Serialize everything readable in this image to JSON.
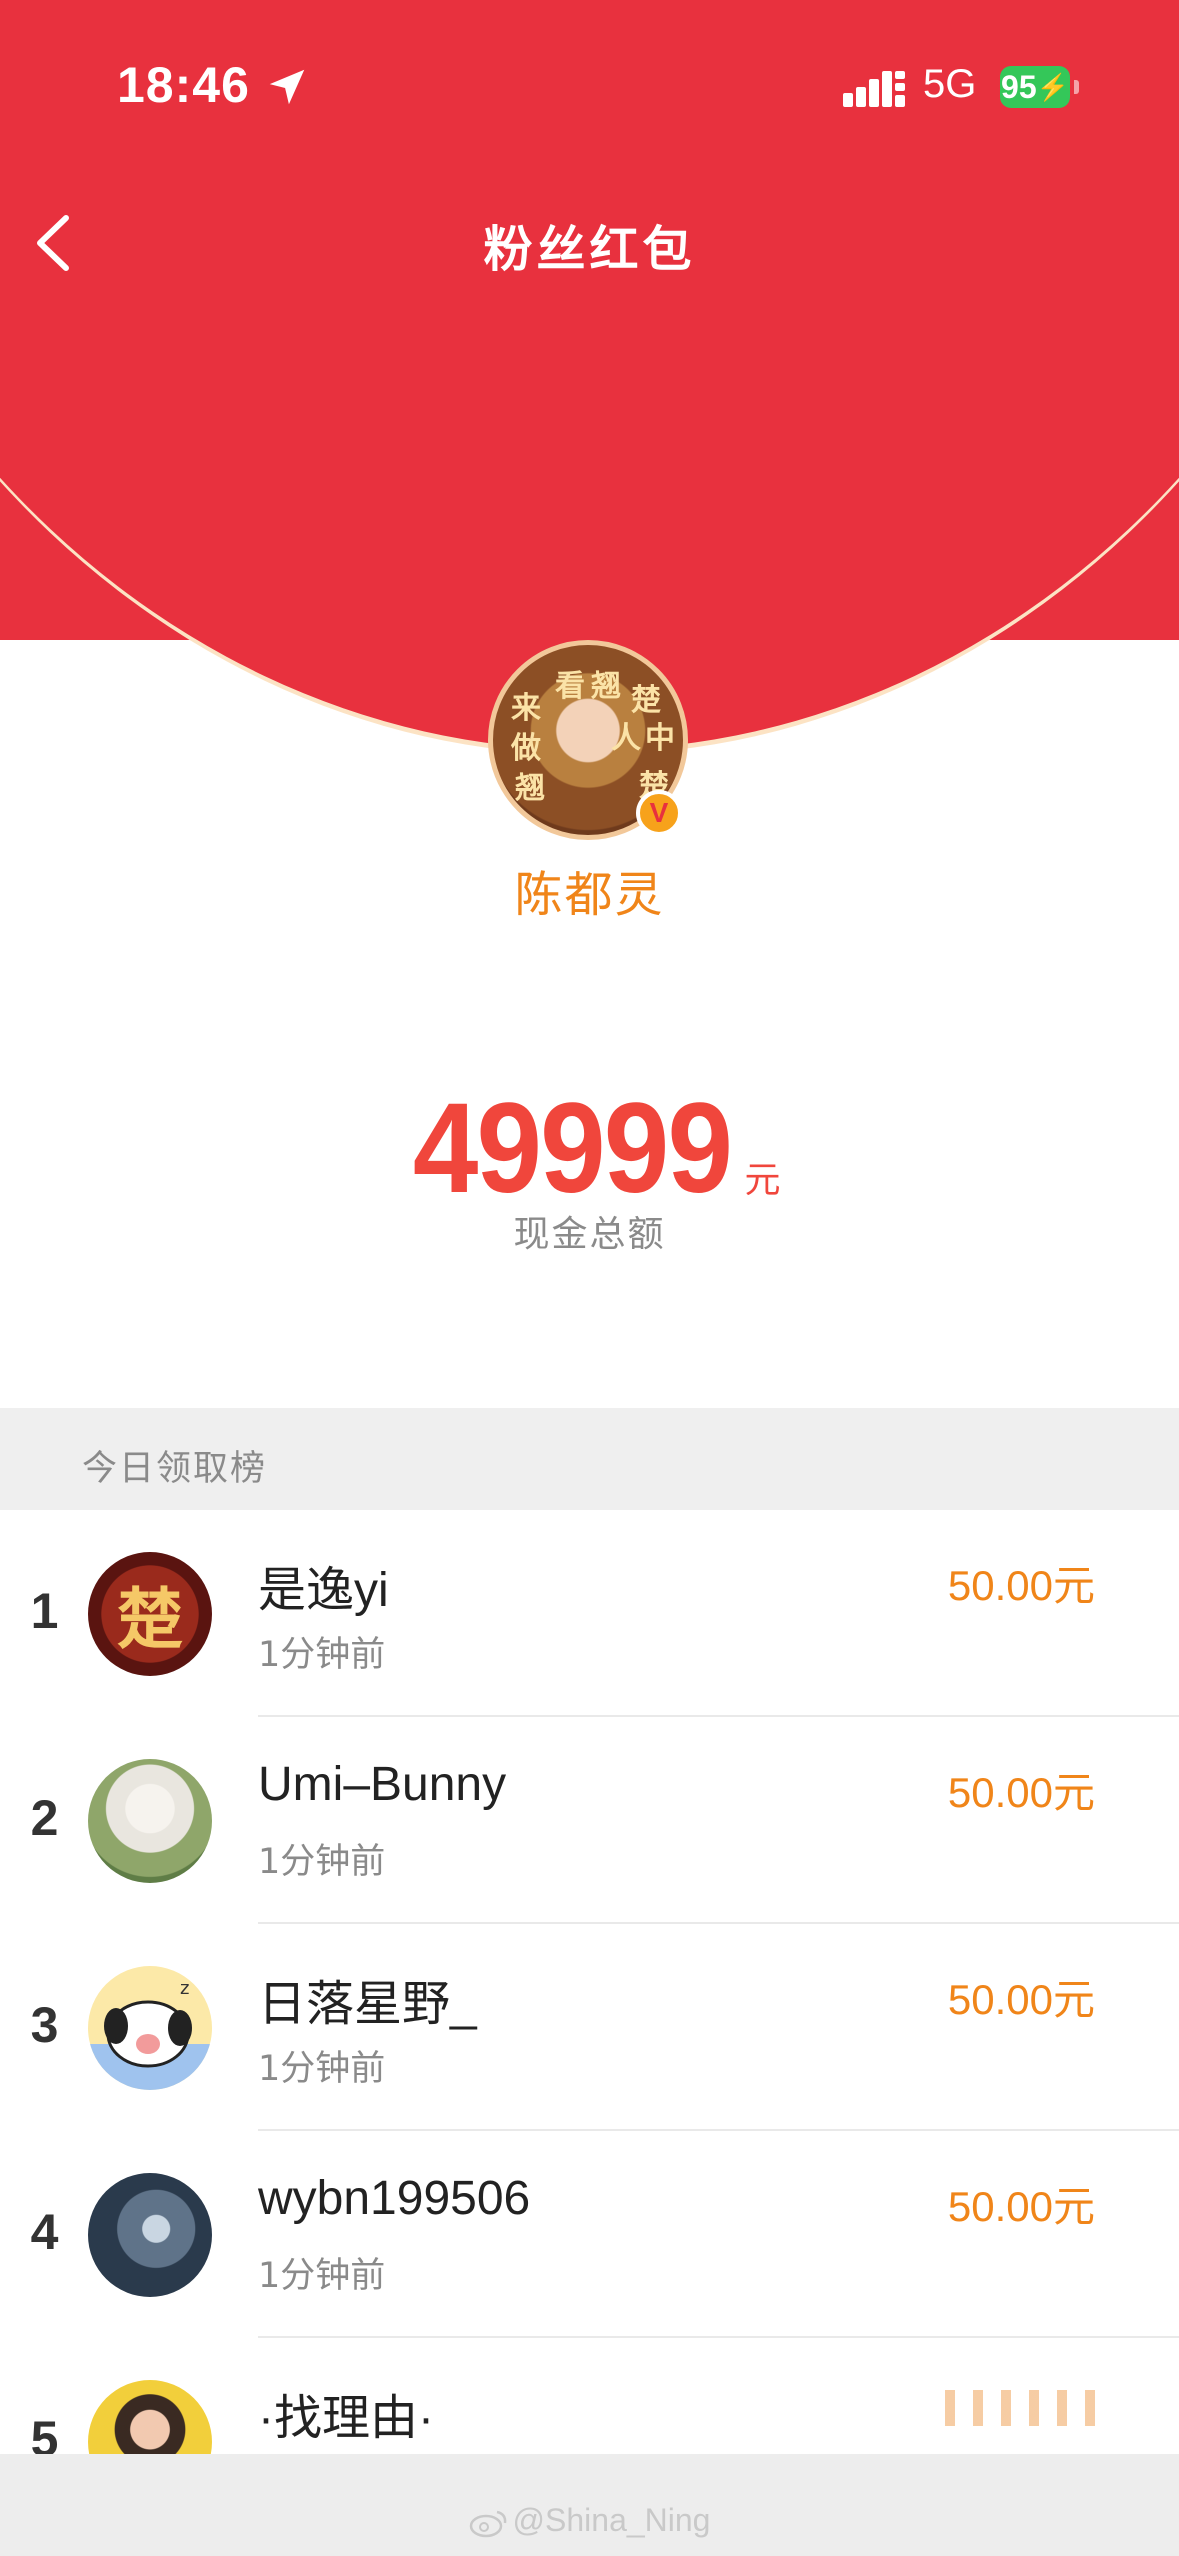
{
  "status_bar": {
    "time": "18:46",
    "network": "5G",
    "battery": "95"
  },
  "nav": {
    "title": "粉丝红包"
  },
  "creator": {
    "name": "陈都灵",
    "verified_badge": "V",
    "avatar_text": [
      "来",
      "看",
      "翘",
      "楚",
      "做",
      "人",
      "中",
      "翘",
      "楚"
    ]
  },
  "amount": {
    "value": "49999",
    "unit": "元",
    "label": "现金总额"
  },
  "ranking": {
    "title": "今日领取榜",
    "rows": [
      {
        "rank": "1",
        "name": "是逸yi",
        "time": "1分钟前",
        "amount": "50.00元"
      },
      {
        "rank": "2",
        "name": "Umi–Bunny",
        "time": "1分钟前",
        "amount": "50.00元"
      },
      {
        "rank": "3",
        "name": "日落星野_",
        "time": "1分钟前",
        "amount": "50.00元"
      },
      {
        "rank": "4",
        "name": "wybn199506",
        "time": "1分钟前",
        "amount": "50.00元"
      },
      {
        "rank": "5",
        "name": "·找理由·",
        "time": "",
        "amount": ""
      }
    ]
  },
  "avatar1_char": "楚",
  "watermark": "@Shina_Ning",
  "colors": {
    "header_red": "#E8313E",
    "accent_orange": "#F08519",
    "amount_red": "#F0463C"
  }
}
